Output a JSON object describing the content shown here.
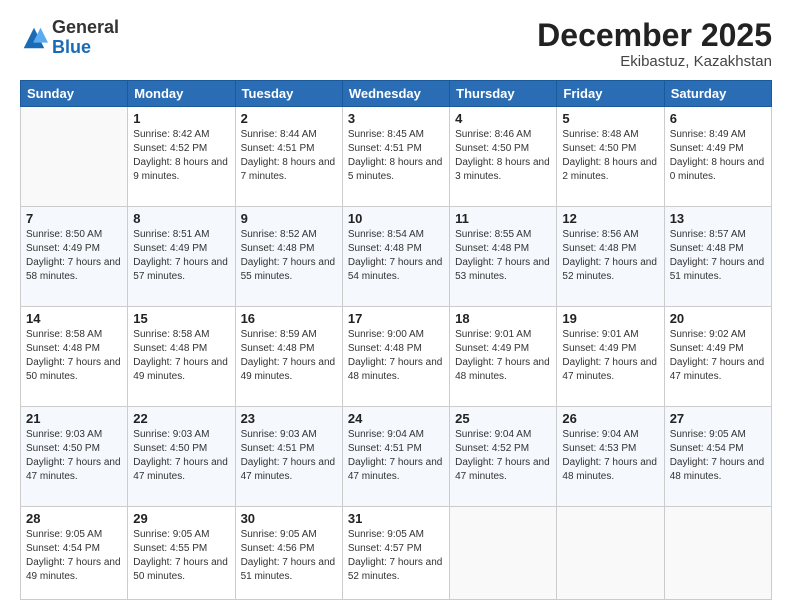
{
  "header": {
    "logo_general": "General",
    "logo_blue": "Blue",
    "month_year": "December 2025",
    "location": "Ekibastuz, Kazakhstan"
  },
  "days_of_week": [
    "Sunday",
    "Monday",
    "Tuesday",
    "Wednesday",
    "Thursday",
    "Friday",
    "Saturday"
  ],
  "weeks": [
    [
      {
        "day": "",
        "content": ""
      },
      {
        "day": "1",
        "content": "Sunrise: 8:42 AM\nSunset: 4:52 PM\nDaylight: 8 hours\nand 9 minutes."
      },
      {
        "day": "2",
        "content": "Sunrise: 8:44 AM\nSunset: 4:51 PM\nDaylight: 8 hours\nand 7 minutes."
      },
      {
        "day": "3",
        "content": "Sunrise: 8:45 AM\nSunset: 4:51 PM\nDaylight: 8 hours\nand 5 minutes."
      },
      {
        "day": "4",
        "content": "Sunrise: 8:46 AM\nSunset: 4:50 PM\nDaylight: 8 hours\nand 3 minutes."
      },
      {
        "day": "5",
        "content": "Sunrise: 8:48 AM\nSunset: 4:50 PM\nDaylight: 8 hours\nand 2 minutes."
      },
      {
        "day": "6",
        "content": "Sunrise: 8:49 AM\nSunset: 4:49 PM\nDaylight: 8 hours\nand 0 minutes."
      }
    ],
    [
      {
        "day": "7",
        "content": "Sunrise: 8:50 AM\nSunset: 4:49 PM\nDaylight: 7 hours\nand 58 minutes."
      },
      {
        "day": "8",
        "content": "Sunrise: 8:51 AM\nSunset: 4:49 PM\nDaylight: 7 hours\nand 57 minutes."
      },
      {
        "day": "9",
        "content": "Sunrise: 8:52 AM\nSunset: 4:48 PM\nDaylight: 7 hours\nand 55 minutes."
      },
      {
        "day": "10",
        "content": "Sunrise: 8:54 AM\nSunset: 4:48 PM\nDaylight: 7 hours\nand 54 minutes."
      },
      {
        "day": "11",
        "content": "Sunrise: 8:55 AM\nSunset: 4:48 PM\nDaylight: 7 hours\nand 53 minutes."
      },
      {
        "day": "12",
        "content": "Sunrise: 8:56 AM\nSunset: 4:48 PM\nDaylight: 7 hours\nand 52 minutes."
      },
      {
        "day": "13",
        "content": "Sunrise: 8:57 AM\nSunset: 4:48 PM\nDaylight: 7 hours\nand 51 minutes."
      }
    ],
    [
      {
        "day": "14",
        "content": "Sunrise: 8:58 AM\nSunset: 4:48 PM\nDaylight: 7 hours\nand 50 minutes."
      },
      {
        "day": "15",
        "content": "Sunrise: 8:58 AM\nSunset: 4:48 PM\nDaylight: 7 hours\nand 49 minutes."
      },
      {
        "day": "16",
        "content": "Sunrise: 8:59 AM\nSunset: 4:48 PM\nDaylight: 7 hours\nand 49 minutes."
      },
      {
        "day": "17",
        "content": "Sunrise: 9:00 AM\nSunset: 4:48 PM\nDaylight: 7 hours\nand 48 minutes."
      },
      {
        "day": "18",
        "content": "Sunrise: 9:01 AM\nSunset: 4:49 PM\nDaylight: 7 hours\nand 48 minutes."
      },
      {
        "day": "19",
        "content": "Sunrise: 9:01 AM\nSunset: 4:49 PM\nDaylight: 7 hours\nand 47 minutes."
      },
      {
        "day": "20",
        "content": "Sunrise: 9:02 AM\nSunset: 4:49 PM\nDaylight: 7 hours\nand 47 minutes."
      }
    ],
    [
      {
        "day": "21",
        "content": "Sunrise: 9:03 AM\nSunset: 4:50 PM\nDaylight: 7 hours\nand 47 minutes."
      },
      {
        "day": "22",
        "content": "Sunrise: 9:03 AM\nSunset: 4:50 PM\nDaylight: 7 hours\nand 47 minutes."
      },
      {
        "day": "23",
        "content": "Sunrise: 9:03 AM\nSunset: 4:51 PM\nDaylight: 7 hours\nand 47 minutes."
      },
      {
        "day": "24",
        "content": "Sunrise: 9:04 AM\nSunset: 4:51 PM\nDaylight: 7 hours\nand 47 minutes."
      },
      {
        "day": "25",
        "content": "Sunrise: 9:04 AM\nSunset: 4:52 PM\nDaylight: 7 hours\nand 47 minutes."
      },
      {
        "day": "26",
        "content": "Sunrise: 9:04 AM\nSunset: 4:53 PM\nDaylight: 7 hours\nand 48 minutes."
      },
      {
        "day": "27",
        "content": "Sunrise: 9:05 AM\nSunset: 4:54 PM\nDaylight: 7 hours\nand 48 minutes."
      }
    ],
    [
      {
        "day": "28",
        "content": "Sunrise: 9:05 AM\nSunset: 4:54 PM\nDaylight: 7 hours\nand 49 minutes."
      },
      {
        "day": "29",
        "content": "Sunrise: 9:05 AM\nSunset: 4:55 PM\nDaylight: 7 hours\nand 50 minutes."
      },
      {
        "day": "30",
        "content": "Sunrise: 9:05 AM\nSunset: 4:56 PM\nDaylight: 7 hours\nand 51 minutes."
      },
      {
        "day": "31",
        "content": "Sunrise: 9:05 AM\nSunset: 4:57 PM\nDaylight: 7 hours\nand 52 minutes."
      },
      {
        "day": "",
        "content": ""
      },
      {
        "day": "",
        "content": ""
      },
      {
        "day": "",
        "content": ""
      }
    ]
  ]
}
